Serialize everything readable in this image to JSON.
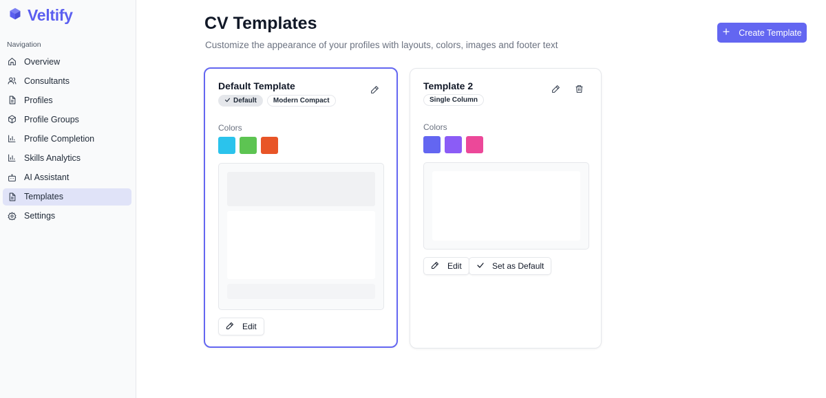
{
  "brand": {
    "name": "Veltify",
    "icon": "cube-icon",
    "accent": "#5b5ff0"
  },
  "sidebar": {
    "heading": "Navigation",
    "items": [
      {
        "label": "Overview",
        "icon": "home-icon",
        "active": false
      },
      {
        "label": "Consultants",
        "icon": "users-icon",
        "active": false
      },
      {
        "label": "Profiles",
        "icon": "document-icon",
        "active": false
      },
      {
        "label": "Profile Groups",
        "icon": "box-icon",
        "active": false
      },
      {
        "label": "Profile Completion",
        "icon": "bar-chart-icon",
        "active": false
      },
      {
        "label": "Skills Analytics",
        "icon": "bar-chart-icon",
        "active": false
      },
      {
        "label": "AI Assistant",
        "icon": "bot-icon",
        "active": false
      },
      {
        "label": "Templates",
        "icon": "document-icon",
        "active": true
      },
      {
        "label": "Settings",
        "icon": "gear-icon",
        "active": false
      }
    ]
  },
  "header": {
    "title": "CV Templates",
    "subtitle": "Customize the appearance of your profiles with layouts, colors, images and footer text",
    "create_label": "Create Template"
  },
  "templates": [
    {
      "name": "Default Template",
      "is_default": true,
      "default_badge": "Default",
      "layout_badge": "Modern Compact",
      "colors_label": "Colors",
      "colors": [
        "#2bc3ec",
        "#5dc452",
        "#e85527"
      ],
      "edit_label": "Edit"
    },
    {
      "name": "Template 2",
      "is_default": false,
      "layout_badge": "Single Column",
      "colors_label": "Colors",
      "colors": [
        "#6366f1",
        "#8b5cf6",
        "#ec4899"
      ],
      "edit_label": "Edit",
      "set_default_label": "Set as Default"
    }
  ]
}
